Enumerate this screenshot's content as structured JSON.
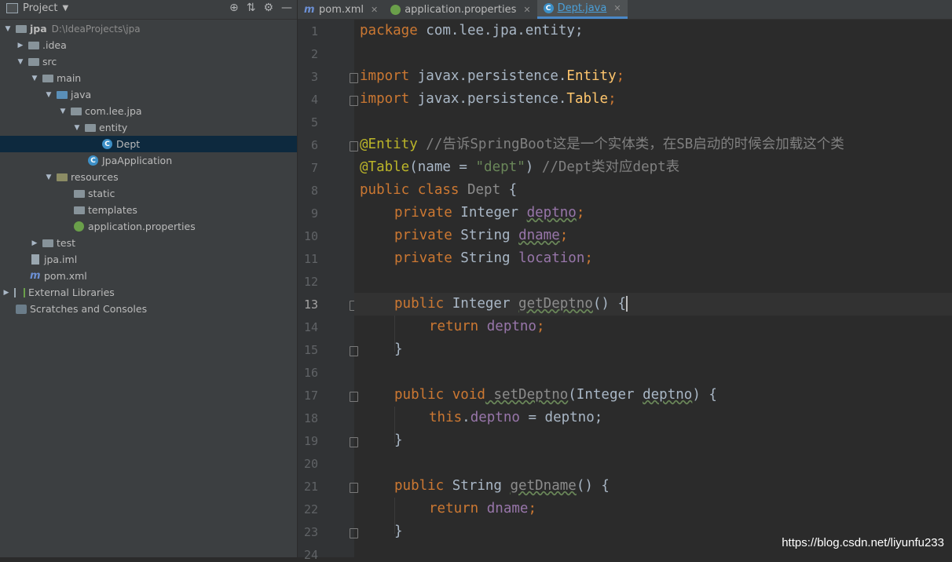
{
  "project_panel": {
    "title": "Project",
    "tree": [
      {
        "label": "jpa",
        "path": "D:\\IdeaProjects\\jpa",
        "depth": 0,
        "expanded": true,
        "icon": "module-folder-icon"
      },
      {
        "label": ".idea",
        "depth": 1,
        "expanded": false,
        "icon": "folder-icon"
      },
      {
        "label": "src",
        "depth": 1,
        "expanded": true,
        "icon": "folder-icon"
      },
      {
        "label": "main",
        "depth": 2,
        "expanded": true,
        "icon": "folder-icon"
      },
      {
        "label": "java",
        "depth": 3,
        "expanded": true,
        "icon": "source-folder-icon"
      },
      {
        "label": "com.lee.jpa",
        "depth": 4,
        "expanded": true,
        "icon": "package-icon"
      },
      {
        "label": "entity",
        "depth": 5,
        "expanded": true,
        "icon": "package-icon"
      },
      {
        "label": "Dept",
        "depth": 6,
        "selected": true,
        "icon": "class-icon"
      },
      {
        "label": "JpaApplication",
        "depth": 5,
        "icon": "spring-class-icon"
      },
      {
        "label": "resources",
        "depth": 3,
        "expanded": true,
        "icon": "resources-folder-icon"
      },
      {
        "label": "static",
        "depth": 4,
        "icon": "folder-icon"
      },
      {
        "label": "templates",
        "depth": 4,
        "icon": "folder-icon"
      },
      {
        "label": "application.properties",
        "depth": 4,
        "icon": "spring-properties-icon"
      },
      {
        "label": "test",
        "depth": 2,
        "expanded": false,
        "icon": "folder-icon"
      },
      {
        "label": "jpa.iml",
        "depth": 1,
        "icon": "iml-file-icon"
      },
      {
        "label": "pom.xml",
        "depth": 1,
        "icon": "maven-icon"
      },
      {
        "label": "External Libraries",
        "depth": 0,
        "expanded": false,
        "icon": "libraries-icon"
      },
      {
        "label": "Scratches and Consoles",
        "depth": 0,
        "icon": "scratches-icon"
      }
    ]
  },
  "tabs": [
    {
      "label": "pom.xml",
      "icon": "maven-icon"
    },
    {
      "label": "application.properties",
      "icon": "spring-properties-icon"
    },
    {
      "label": "Dept.java",
      "icon": "class-icon",
      "active": true
    }
  ],
  "editor": {
    "current_line": 13,
    "line_numbers": [
      "1",
      "2",
      "3",
      "4",
      "5",
      "6",
      "7",
      "8",
      "9",
      "10",
      "11",
      "12",
      "13",
      "14",
      "15",
      "16",
      "17",
      "18",
      "19",
      "20",
      "21",
      "22",
      "23",
      "24"
    ],
    "code": {
      "l1_kw": "package",
      "l1_rest": " com.lee.jpa.entity;",
      "l3_kw": "import",
      "l3_pkg": " javax.persistence.",
      "l3_cls": "Entity",
      "l3_semi": ";",
      "l4_kw": "import",
      "l4_pkg": " javax.persistence.",
      "l4_cls": "Table",
      "l4_semi": ";",
      "l6_ann": "@Entity",
      "l6_cmt": " //告诉SpringBoot这是一个实体类，在SB启动的时候会加载这个类",
      "l7_ann": "@Table",
      "l7_open": "(name = ",
      "l7_str": "\"dept\"",
      "l7_close": ")",
      "l7_cmt": " //Dept类对应dept表",
      "l8_kw": "public class",
      "l8_name": " Dept",
      "l8_rest": " {",
      "l9_kw": "private",
      "l9_type": " Integer ",
      "l9_fld": "deptno",
      "l9_semi": ";",
      "l10_kw": "private",
      "l10_type": " String ",
      "l10_fld": "dname",
      "l10_semi": ";",
      "l11_kw": "private",
      "l11_type": " String ",
      "l11_fld": "location",
      "l11_semi": ";",
      "l13_kw": "public",
      "l13_type": " Integer ",
      "l13_mth": "getDeptno",
      "l13_rest": "() {",
      "l14_kw": "return",
      "l14_fld": " deptno",
      "l14_semi": ";",
      "l15": "}",
      "l17_kw": "public void",
      "l17_mth": " setDeptno",
      "l17_rest": "(Integer ",
      "l17_param": "deptno",
      "l17_end": ") {",
      "l18_kw": "this",
      "l18_dot": ".",
      "l18_fld": "deptno",
      "l18_rest": " = deptno;",
      "l19": "}",
      "l21_kw": "public",
      "l21_type": " String ",
      "l21_mth": "getDname",
      "l21_rest": "() {",
      "l22_kw": "return",
      "l22_fld": " dname",
      "l22_semi": ";",
      "l23": "}"
    }
  },
  "watermark": "https://blog.csdn.net/liyunfu233"
}
